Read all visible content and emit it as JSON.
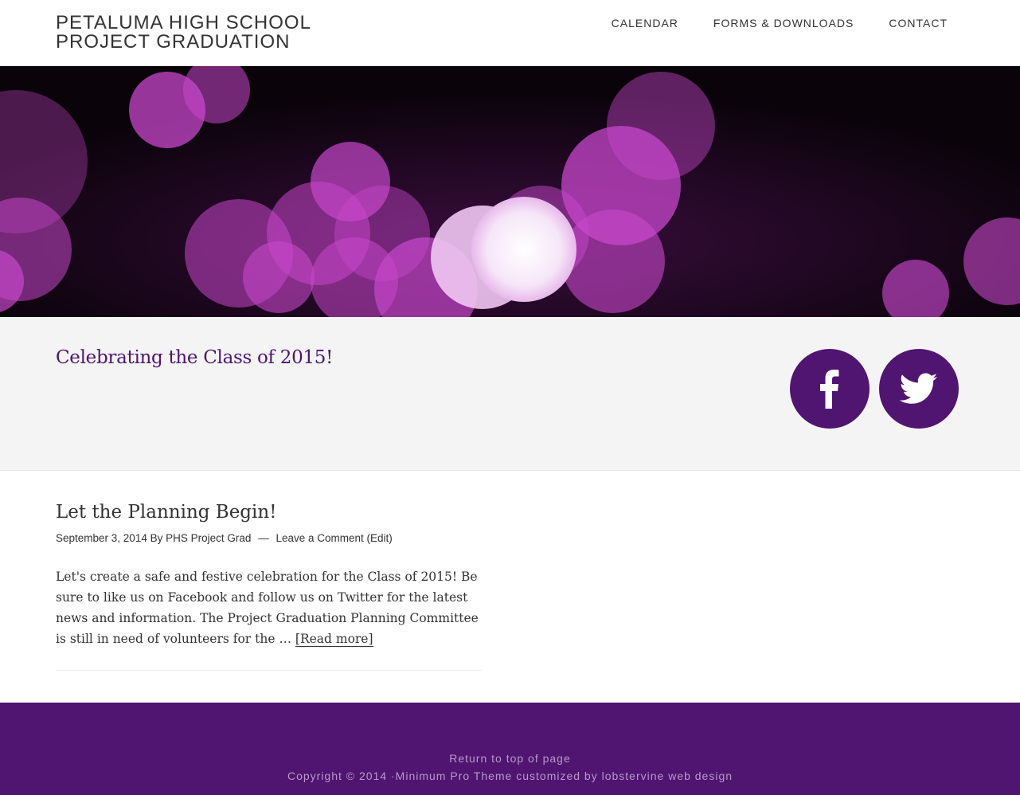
{
  "header": {
    "title_line1": "PETALUMA HIGH SCHOOL",
    "title_line2": "PROJECT GRADUATION",
    "nav": [
      {
        "label": "CALENDAR"
      },
      {
        "label": "FORMS & DOWNLOADS"
      },
      {
        "label": "CONTACT"
      }
    ]
  },
  "hero": {
    "background_color": "#0a030a",
    "bokeh_color": "#c040c8"
  },
  "tagline": {
    "text": "Celebrating the Class of 2015!"
  },
  "social": {
    "accent": "#501570",
    "buttons": [
      {
        "icon": "facebook-icon"
      },
      {
        "icon": "twitter-icon"
      }
    ]
  },
  "post": {
    "title": "Let the Planning Begin!",
    "date": "September 3, 2014",
    "by": "By",
    "author": "PHS Project Grad",
    "separator": "—",
    "comment_link": "Leave a Comment",
    "edit_link": "(Edit)",
    "excerpt": "Let's create a safe and festive celebration for the Class of 2015! Be sure to like us on Facebook and follow us on Twitter for the latest news and information. The Project Graduation Planning Committee is still in need of volunteers for the … ",
    "read_more": "[Read more]"
  },
  "footer": {
    "back_to_top": "Return to top of page",
    "copyright_prefix": "Copyright © 2014 ·",
    "theme_link": "Minimum Pro Theme",
    "customized_by": " customized by ",
    "designer_link": "lobstervine web design",
    "background": "#4f1570"
  }
}
